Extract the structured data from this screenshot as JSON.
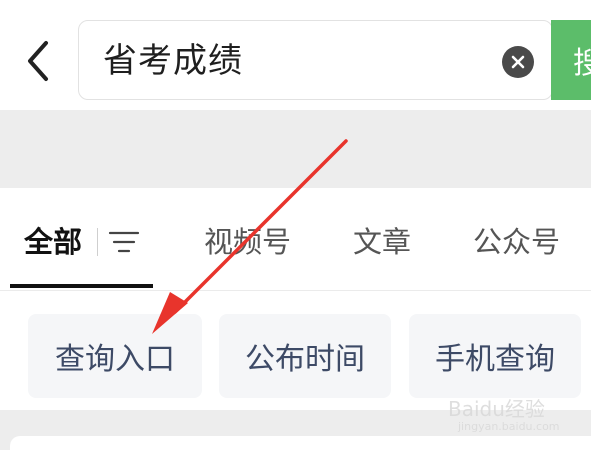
{
  "search": {
    "query": "省考成绩",
    "button_label": "搜"
  },
  "tabs": [
    {
      "label": "全部",
      "active": true
    },
    {
      "label": "视频号",
      "active": false
    },
    {
      "label": "文章",
      "active": false
    },
    {
      "label": "公众号",
      "active": false
    }
  ],
  "suggestions": [
    {
      "label": "查询入口"
    },
    {
      "label": "公布时间"
    },
    {
      "label": "手机查询"
    }
  ],
  "watermark": {
    "text": "Baidu经验",
    "sub": "jingyan.baidu.com"
  },
  "colors": {
    "accent": "#5cbd6a",
    "annotation_arrow": "#e8342c"
  }
}
